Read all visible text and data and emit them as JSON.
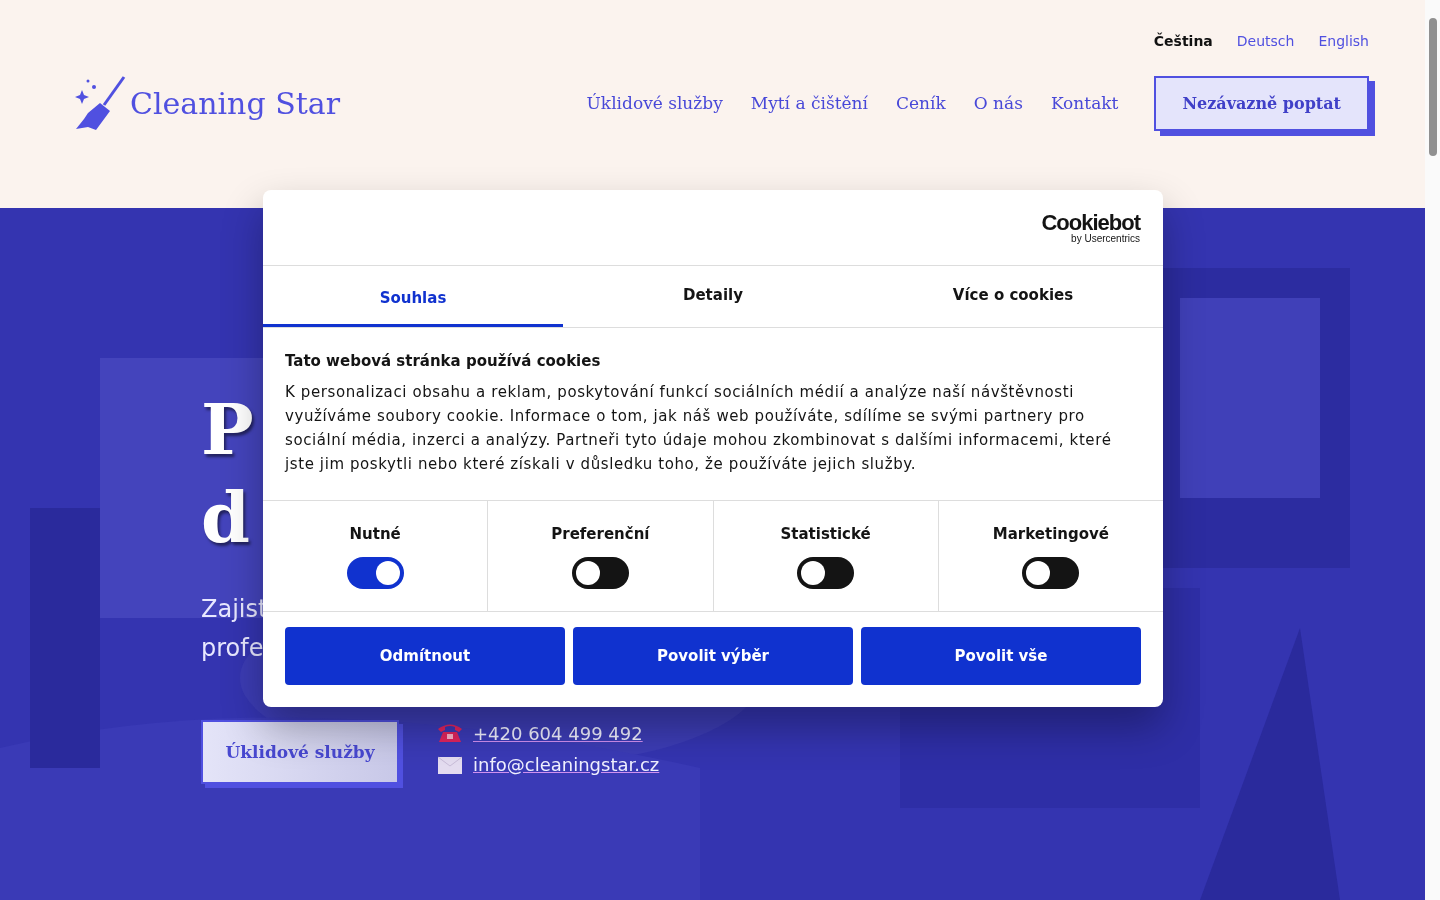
{
  "header": {
    "languages": [
      {
        "label": "Čeština",
        "selected": true
      },
      {
        "label": "Deutsch",
        "selected": false
      },
      {
        "label": "English",
        "selected": false
      }
    ],
    "logo": "Cleaning Star",
    "nav": [
      "Úklidové služby",
      "Mytí a čištění",
      "Ceník",
      "O nás",
      "Kontakt"
    ],
    "cta": "Nezávazně poptat"
  },
  "hero": {
    "headline": [
      "P",
      "d"
    ],
    "subtitle": [
      "Zajist",
      "profe"
    ],
    "button": "Úklidové služby",
    "phone": "+420 604 499 492",
    "email": "info@cleaningstar.cz"
  },
  "cookie_dialog": {
    "brand": "Cookiebot",
    "brand_sub": "by Usercentrics",
    "tabs": [
      {
        "label": "Souhlas",
        "selected": true
      },
      {
        "label": "Detaily",
        "selected": false
      },
      {
        "label": "Více o cookies",
        "selected": false
      }
    ],
    "title": "Tato webová stránka používá cookies",
    "text": "K personalizaci obsahu a reklam, poskytování funkcí sociálních médií a analýze naší návštěvnosti využíváme soubory cookie. Informace o tom, jak náš web používáte, sdílíme se svými partnery pro sociální média, inzerci a analýzy. Partneři tyto údaje mohou zkombinovat s dalšími informacemi, které jste jim poskytli nebo které získali v důsledku toho, že používáte jejich služby.",
    "categories": [
      {
        "label": "Nutné",
        "on": true
      },
      {
        "label": "Preferenční",
        "on": false
      },
      {
        "label": "Statistické",
        "on": false
      },
      {
        "label": "Marketingové",
        "on": false
      }
    ],
    "buttons": [
      "Odmítnout",
      "Povolit výběr",
      "Povolit vše"
    ]
  }
}
